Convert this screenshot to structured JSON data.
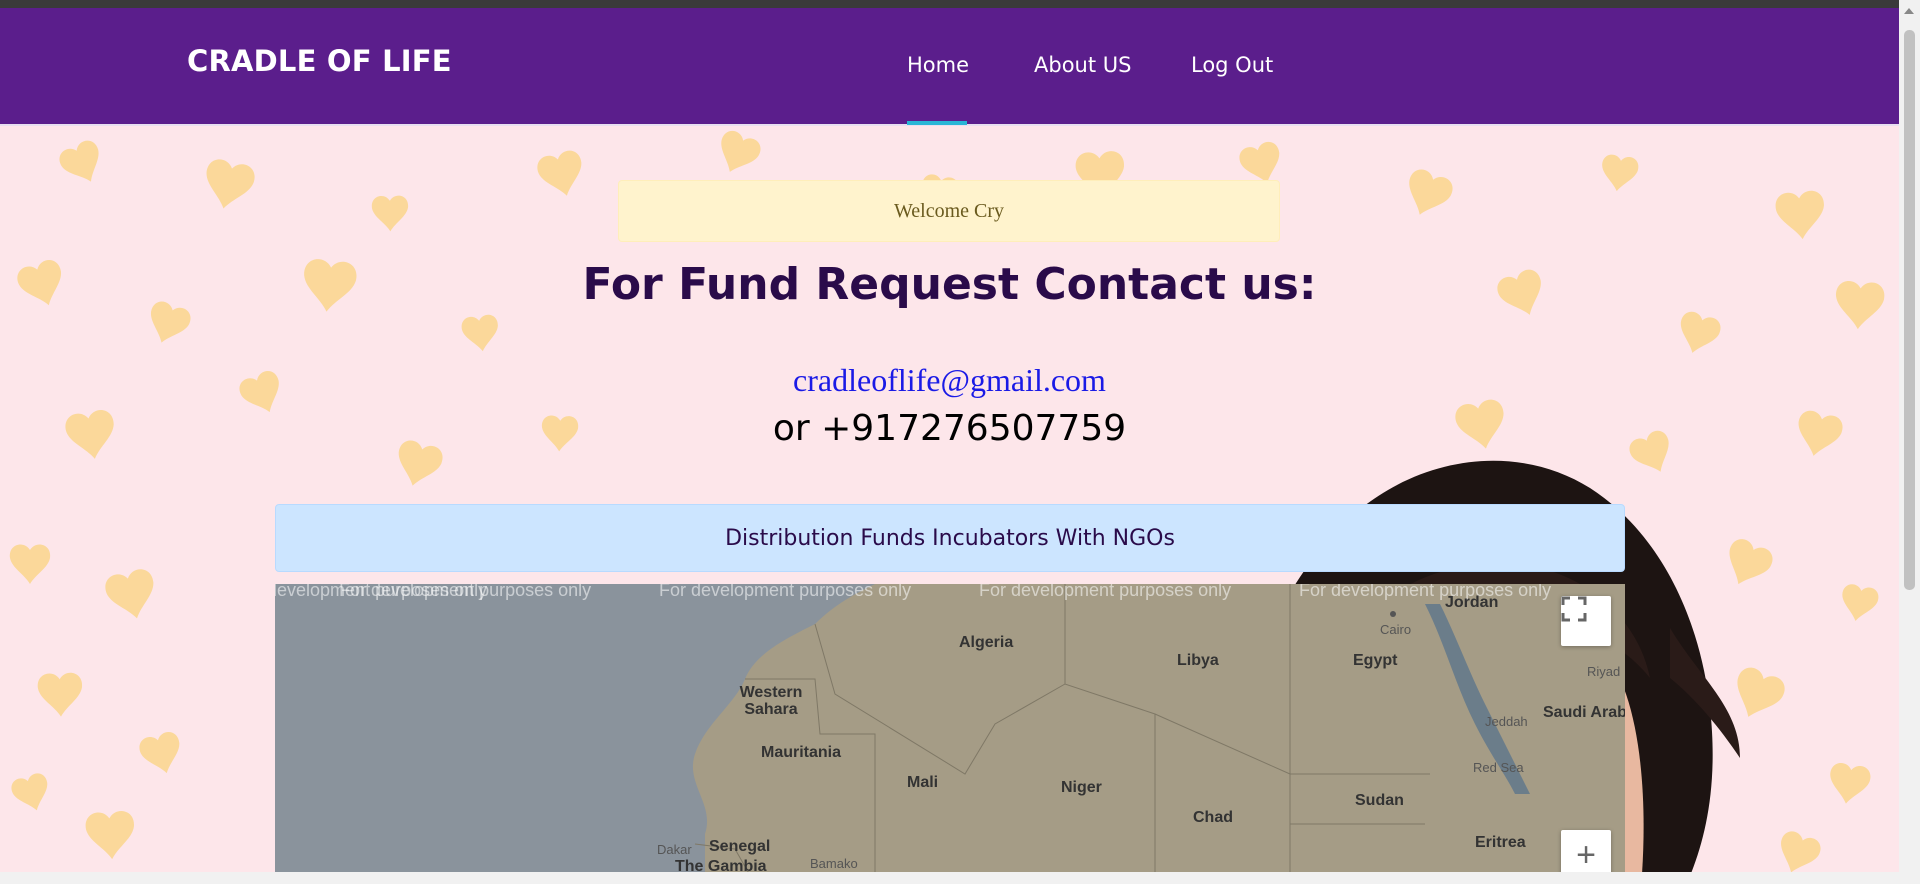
{
  "navbar": {
    "brand": "CRADLE OF LIFE",
    "links": [
      {
        "label": "Home",
        "active": true
      },
      {
        "label": "About US"
      },
      {
        "label": "Log Out"
      }
    ],
    "background": "#5b1e8c",
    "active_underline_color": "#29b6d6"
  },
  "welcome": {
    "text": "Welcome Cry"
  },
  "contact": {
    "heading": "For Fund Request Contact us:",
    "email": "cradleoflife@gmail.com",
    "phone": "or +917276507759"
  },
  "distribution": {
    "title": "Distribution Funds Incubators With NGOs"
  },
  "map": {
    "watermark": "For development purposes only",
    "labels": [
      "Algeria",
      "Libya",
      "Egypt",
      "Western Sahara",
      "Mauritania",
      "Mali",
      "Niger",
      "Chad",
      "Sudan",
      "Senegal",
      "The Gambia",
      "Jordan",
      "Saudi Arab",
      "Eritrea",
      "Cairo",
      "Riyad",
      "Jeddah",
      "Red Sea",
      "Dakar",
      "Bamako"
    ],
    "fullscreen_icon": "fullscreen-icon",
    "zoom_in_label": "+"
  },
  "colors": {
    "page_background": "#fde6ea",
    "hearts": "#fbd89a",
    "heading": "#2a0b4a",
    "email_link": "#1a1ae6"
  }
}
